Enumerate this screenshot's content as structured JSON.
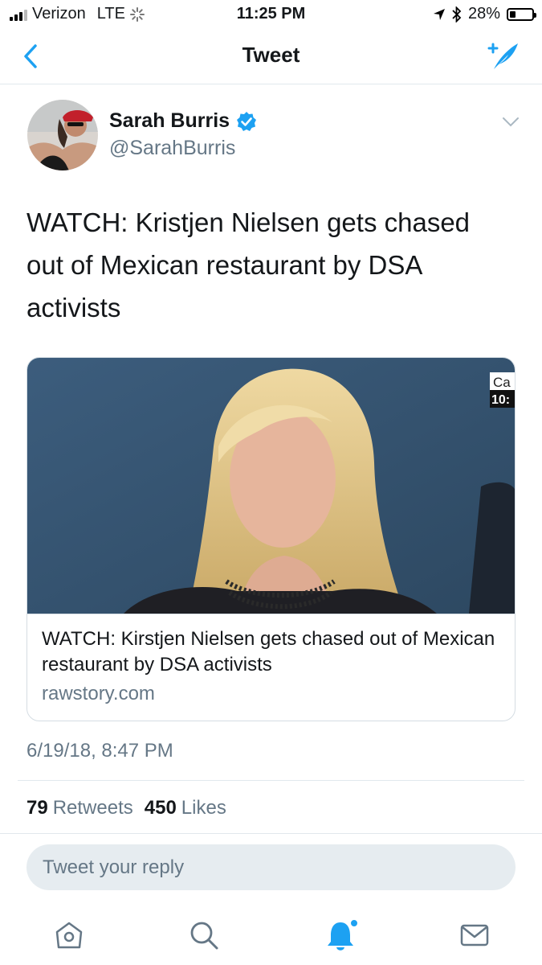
{
  "status_bar": {
    "carrier": "Verizon",
    "network": "LTE",
    "time": "11:25 PM",
    "battery": "28%",
    "battery_level": 0.28
  },
  "nav": {
    "title": "Tweet",
    "back_icon": "chevron-left-icon",
    "compose_icon": "compose-tweet-icon"
  },
  "tweet": {
    "author_name": "Sarah Burris",
    "author_handle": "@SarahBurris",
    "verified": true,
    "text": "WATCH: Kristjen Nielsen gets chased out of Mexican restaurant by DSA activists",
    "timestamp": "6/19/18, 8:47 PM",
    "card": {
      "title": "WATCH: Kirstjen Nielsen gets chased out of Mexican restaurant by DSA activists",
      "domain": "rawstory.com",
      "overlay_line1": "Ca",
      "overlay_line2": "10:"
    },
    "retweets": "79",
    "retweets_label": "Retweets",
    "likes": "450",
    "likes_label": "Likes"
  },
  "reply": {
    "placeholder": "Tweet your reply"
  },
  "tab_bar": {
    "items": [
      "home-icon",
      "search-icon",
      "notifications-icon",
      "messages-icon"
    ],
    "active": "notifications-icon"
  },
  "colors": {
    "brand": "#1da1f2",
    "secondary_text": "#657786",
    "divider": "#e1e8ed"
  }
}
